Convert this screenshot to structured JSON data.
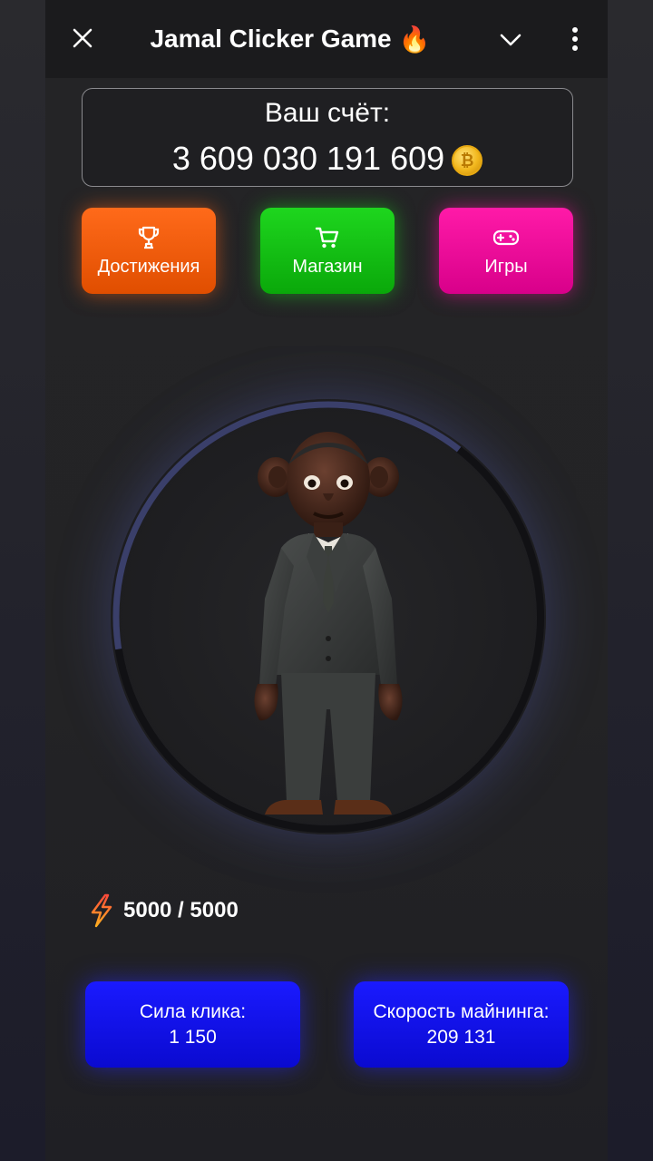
{
  "header": {
    "title": "Jamal Clicker Game",
    "title_emoji": "🔥"
  },
  "score": {
    "label": "Ваш счёт:",
    "value": "3 609 030 191 609"
  },
  "nav": [
    {
      "label": "Достижения",
      "icon": "trophy-icon",
      "color": "#ff6a1a"
    },
    {
      "label": "Магазин",
      "icon": "cart-icon",
      "color": "#14c014"
    },
    {
      "label": "Игры",
      "icon": "gamepad-icon",
      "color": "#ff1aa8"
    }
  ],
  "clicker": {
    "progress_fraction": 0.62,
    "ring_track_color": "#3a3f6a",
    "ring_fill_color": "#111114"
  },
  "energy": {
    "value": "5000 / 5000",
    "icon": "lightning-icon"
  },
  "stats": {
    "click_power_label": "Сила клика:",
    "click_power_value": "1 150",
    "mining_speed_label": "Скорость майнинга:",
    "mining_speed_value": "209 131"
  },
  "colors": {
    "stat_button": "#1010f0",
    "coin": "#f2b81e"
  }
}
